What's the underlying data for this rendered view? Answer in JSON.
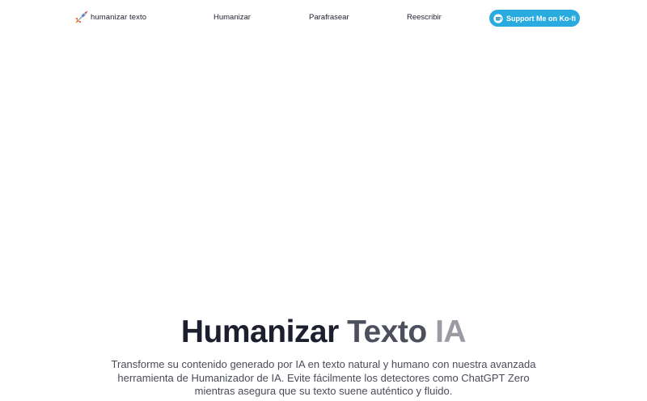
{
  "nav": {
    "brand": "humanizar texto",
    "links": [
      "Humanizar",
      "Parafrasear",
      "Reescribir"
    ],
    "support_button": "Support Me on Ko-fi"
  },
  "hero": {
    "title_part1": "Humanizar",
    "title_part2": "Texto",
    "title_part3": "IA",
    "description": "Transforme su contenido generado por IA en texto natural y humano con nuestra avanzada herramienta de Humanizador de IA. Evite fácilmente los detectores como ChatGPT Zero mientras asegura que su texto suene auténtico y fluido."
  },
  "colors": {
    "kofi_button": "#29abe0",
    "title_dark": "#1e1f2e",
    "title_gray": "#9a9ba3"
  },
  "icons": {
    "brand": "rocket-icon",
    "support": "kofi-cup-icon"
  }
}
